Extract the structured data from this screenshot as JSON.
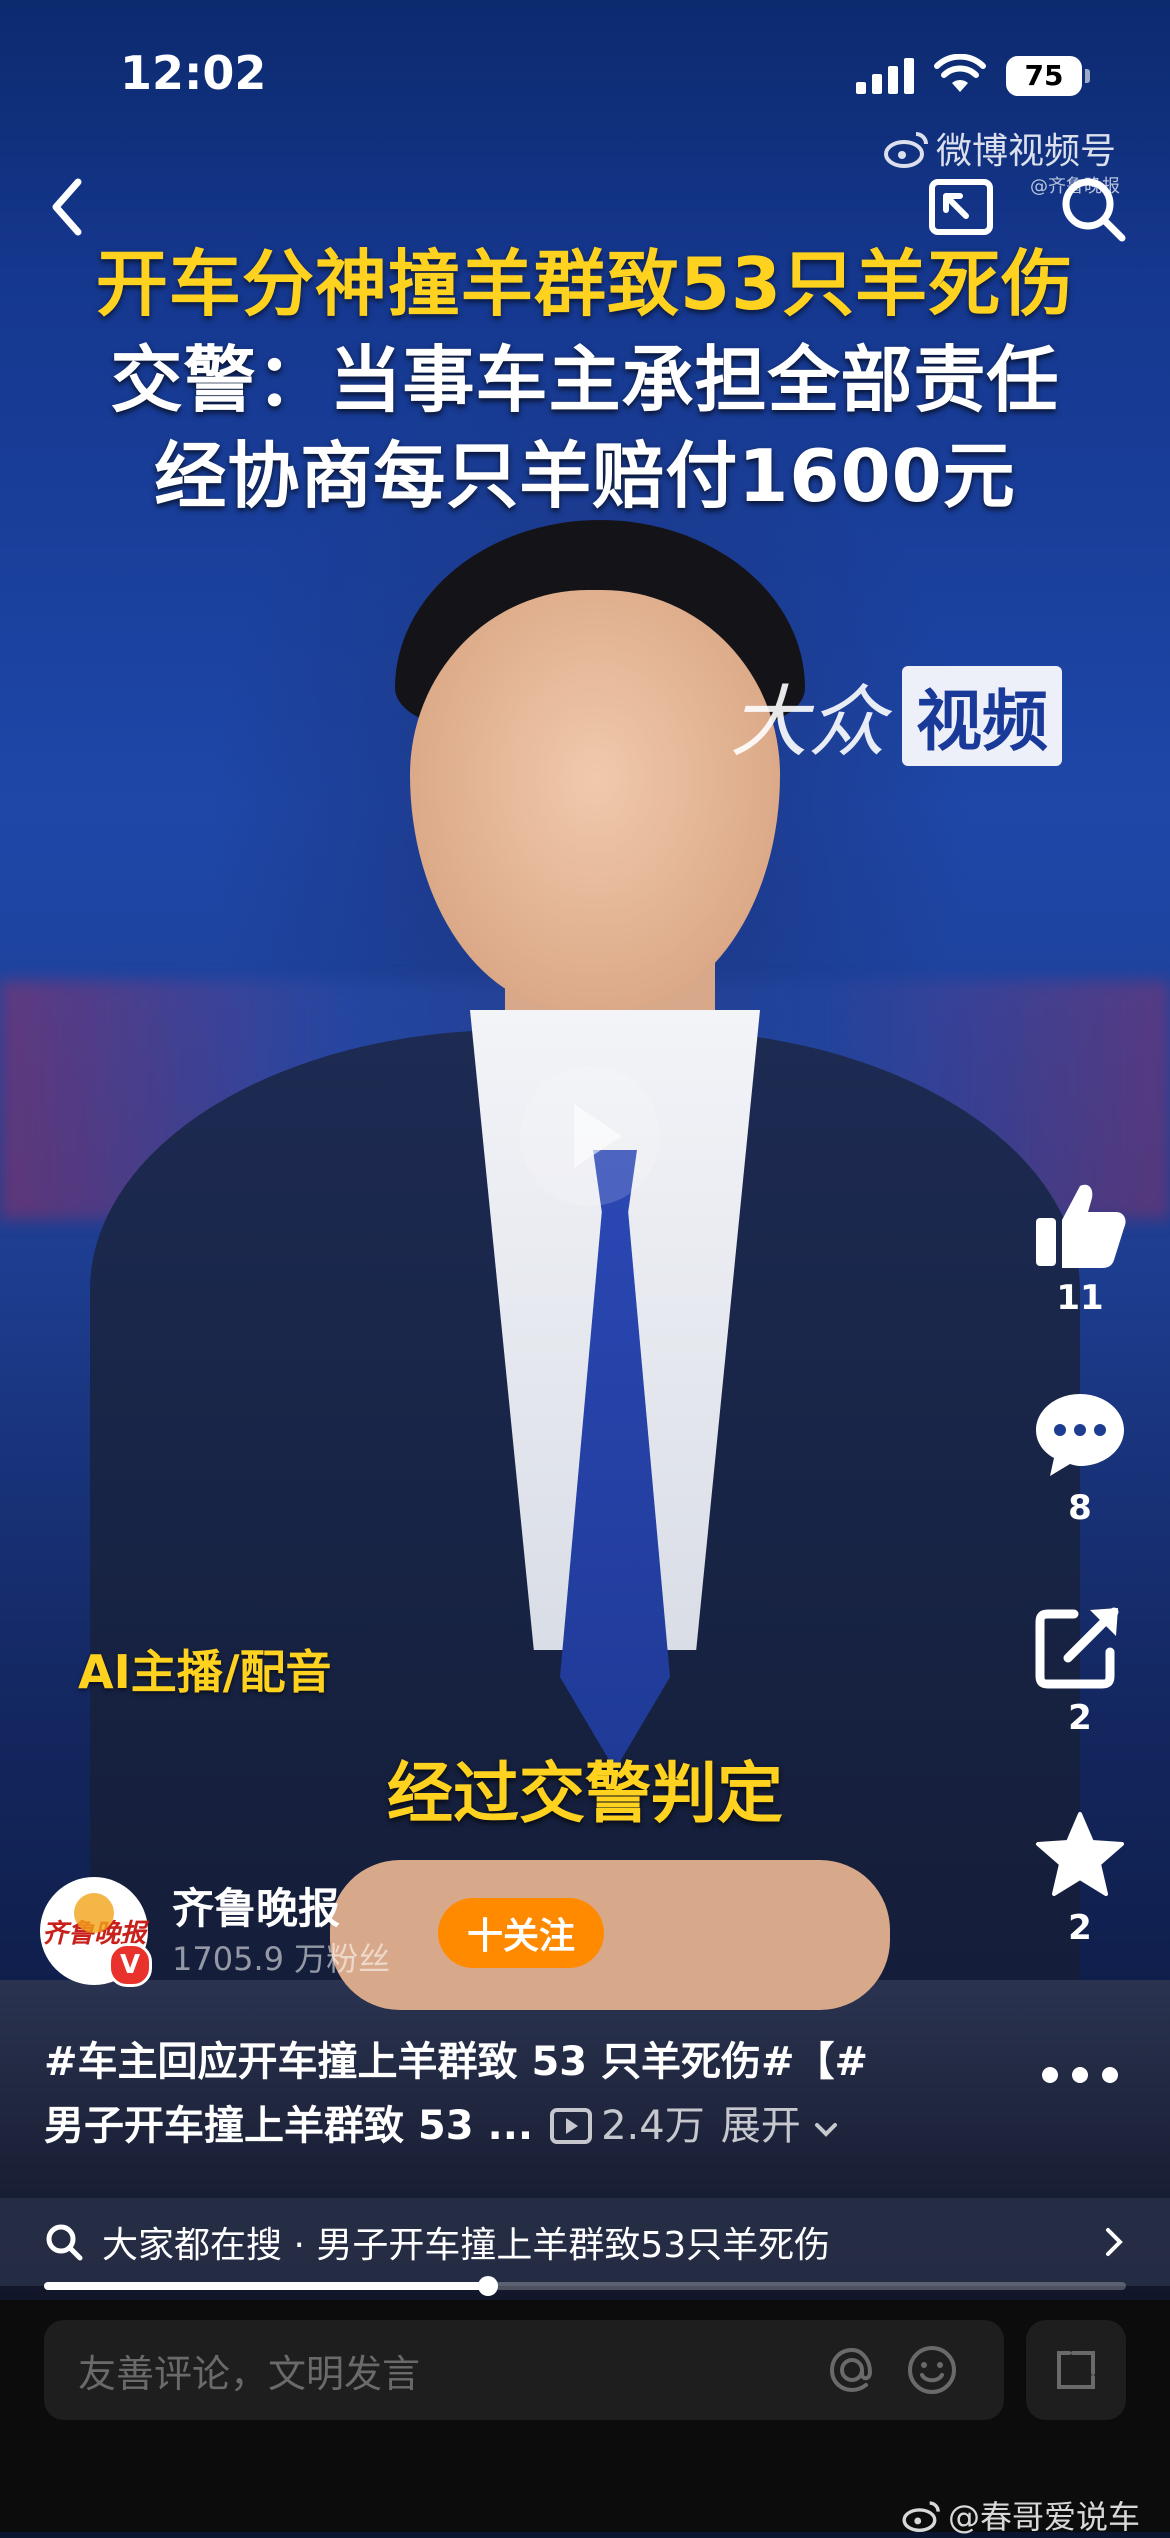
{
  "status_bar": {
    "time": "12:02",
    "battery": "75"
  },
  "watermark": {
    "platform": "微博视频号",
    "source": "@齐鲁晚报"
  },
  "headline": {
    "line1": "开车分神撞羊群致53只羊死伤",
    "line2": "交警：当事车主承担全部责任",
    "line3": "经协商每只羊赔付1600元"
  },
  "brand": {
    "script": "大众",
    "box": "视频"
  },
  "overlay": {
    "ai_label": "AI主播/配音",
    "subtitle": "经过交警判定"
  },
  "actions": {
    "like_count": "11",
    "comment_count": "8",
    "share_count": "2",
    "favorite_count": "2"
  },
  "author": {
    "avatar_text": "齐鲁晚报",
    "name": "齐鲁晚报",
    "fans": "1705.9 万粉丝",
    "follow_label": "十关注",
    "verified_mark": "V"
  },
  "description": {
    "line1": "#车主回应开车撞上羊群致 53 只羊死伤#【#",
    "line2": "男子开车撞上羊群致 53 ...",
    "views": "2.4万",
    "expand": "展开"
  },
  "search_suggest": {
    "text": "大家都在搜 · 男子开车撞上羊群致53只羊死伤"
  },
  "progress": {
    "fraction": 0.41
  },
  "comment_bar": {
    "placeholder": "友善评论，文明发言"
  },
  "bottom_watermark": "@春哥爱说车",
  "colors": {
    "headline_yellow": "#ffd21f",
    "follow_orange": "#ff8a00",
    "verified_red": "#e8322b"
  },
  "icons": [
    "back-icon",
    "pip-icon",
    "search-icon",
    "play-icon",
    "like-icon",
    "comment-icon",
    "share-icon",
    "star-icon",
    "more-icon",
    "chevron-down-icon",
    "chevron-right-icon",
    "at-icon",
    "emoji-icon",
    "expand-icon",
    "weibo-icon"
  ]
}
